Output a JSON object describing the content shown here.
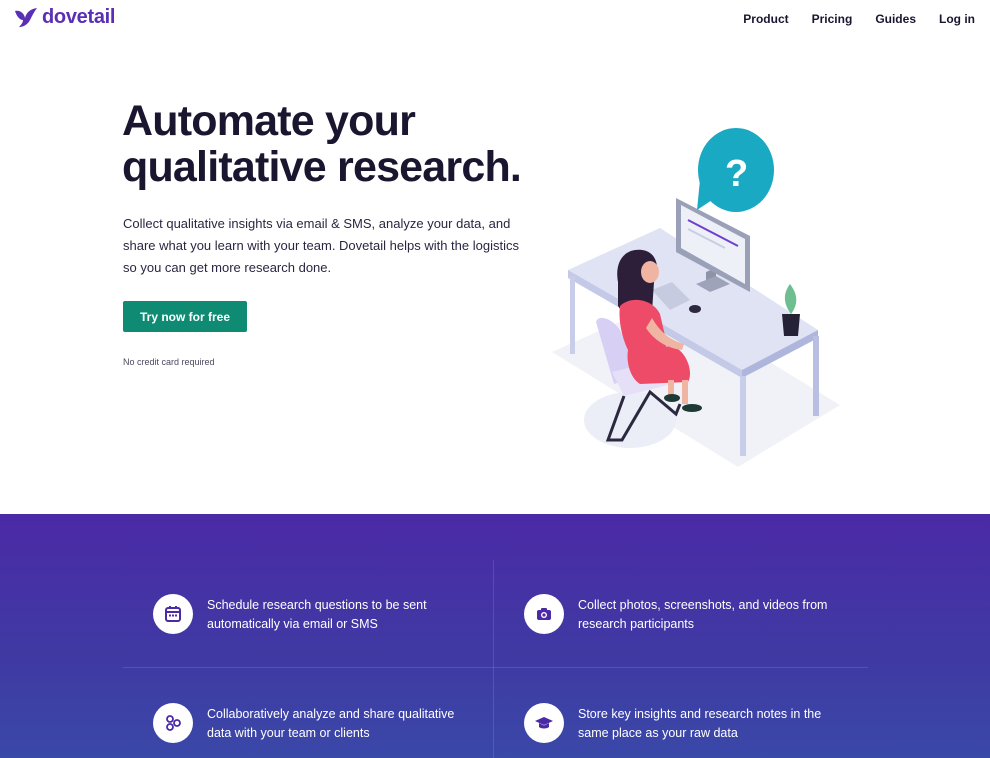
{
  "brand": {
    "name": "dovetail"
  },
  "nav": {
    "items": [
      {
        "label": "Product"
      },
      {
        "label": "Pricing"
      },
      {
        "label": "Guides"
      },
      {
        "label": "Log in"
      }
    ]
  },
  "hero": {
    "title_line1": "Automate your",
    "title_line2": "qualitative research.",
    "description": "Collect qualitative insights via email & SMS, analyze your data, and share what you learn with your team. Dovetail helps with the logistics so you can get more research done.",
    "cta_label": "Try now for free",
    "fine_print": "No credit card required"
  },
  "features": [
    {
      "icon": "calendar-icon",
      "text": "Schedule research questions to be sent automatically via email or SMS"
    },
    {
      "icon": "camera-icon",
      "text": "Collect photos, screenshots, and videos from research participants"
    },
    {
      "icon": "share-nodes-icon",
      "text": "Collaboratively analyze and share qualitative data with your team or clients"
    },
    {
      "icon": "graduation-cap-icon",
      "text": "Store key insights and research notes in the same place as your raw data"
    }
  ],
  "colors": {
    "brand": "#5b2fb5",
    "cta": "#0f8a73",
    "features_bg": "#4b2aa6",
    "text_dark": "#1b1630",
    "bubble": "#1aa9c2"
  }
}
